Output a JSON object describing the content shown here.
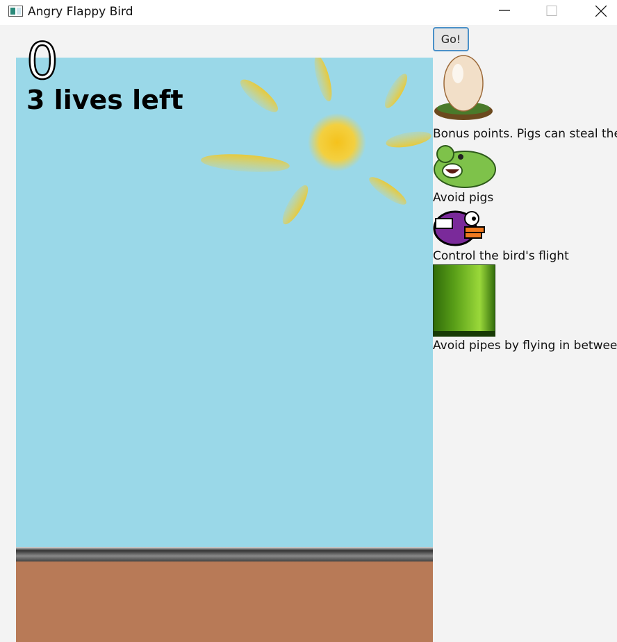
{
  "window": {
    "title": "Angry Flappy Bird",
    "icons": [
      "app-icon",
      "minimize-icon",
      "maximize-icon",
      "close-icon"
    ]
  },
  "game": {
    "score": "0",
    "lives_text": "3 lives left",
    "sky_color": "#9ad8e8",
    "ground_color": "#b87a57"
  },
  "panel": {
    "go_label": "Go!",
    "legend": [
      {
        "icon": "egg-nest-icon",
        "label": "Bonus points. Pigs can steal them"
      },
      {
        "icon": "pig-icon",
        "label": "Avoid pigs"
      },
      {
        "icon": "purple-bird-icon",
        "label": "Control the bird's flight"
      },
      {
        "icon": "pipe-icon",
        "label": "Avoid pipes by flying in between"
      }
    ]
  }
}
